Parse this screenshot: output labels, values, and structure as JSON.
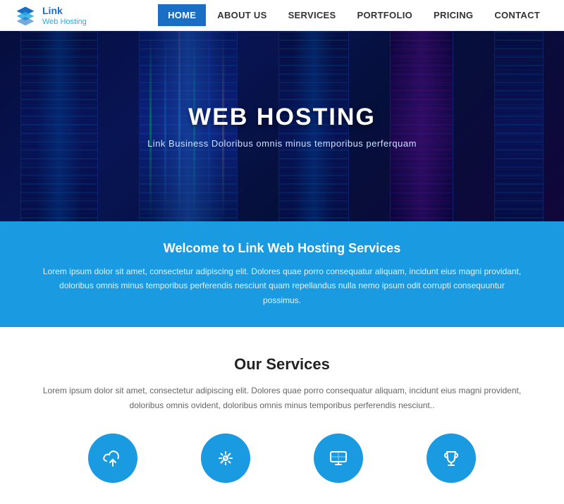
{
  "logo": {
    "brand": "Link",
    "subtitle": "Web Hosting",
    "icon_label": "link-web-hosting-logo"
  },
  "nav": {
    "items": [
      {
        "label": "HOME",
        "active": true
      },
      {
        "label": "ABOUT US",
        "active": false
      },
      {
        "label": "SERVICES",
        "active": false
      },
      {
        "label": "PORTFOLIO",
        "active": false
      },
      {
        "label": "PRICING",
        "active": false
      },
      {
        "label": "CONTACT",
        "active": false
      }
    ]
  },
  "hero": {
    "title": "WEB HOSTING",
    "subtitle": "Link Business Doloribus omnis minus temporibus perferquam"
  },
  "banner": {
    "heading": "Welcome to Link Web Hosting Services",
    "body": "Lorem ipsum dolor sit amet, consectetur adipiscing elit. Dolores quae porro consequatur aliquam, incidunt eius magni providant, doloribus omnis minus temporibus perferendis nesciunt quam repellandus nulla nemo ipsum odit corrupti consequuntur possimus."
  },
  "services": {
    "heading": "Our Services",
    "body": "Lorem ipsum dolor sit amet, consectetur adipiscing elit. Dolores quae porro consequatur aliquam, incidunt eius magni provident, doloribus omnis ovident, doloribus omnis minus temporibus perferendis nesciunt..",
    "icons": [
      {
        "name": "cloud-upload",
        "label": "Cloud Upload"
      },
      {
        "name": "settings-tools",
        "label": "Settings Tools"
      },
      {
        "name": "display-screen",
        "label": "Display Screen"
      },
      {
        "name": "trophy",
        "label": "Trophy"
      }
    ]
  },
  "colors": {
    "nav_active_bg": "#1a6fc4",
    "banner_bg": "#1a9ae0",
    "icon_circle": "#1a9ae0"
  }
}
